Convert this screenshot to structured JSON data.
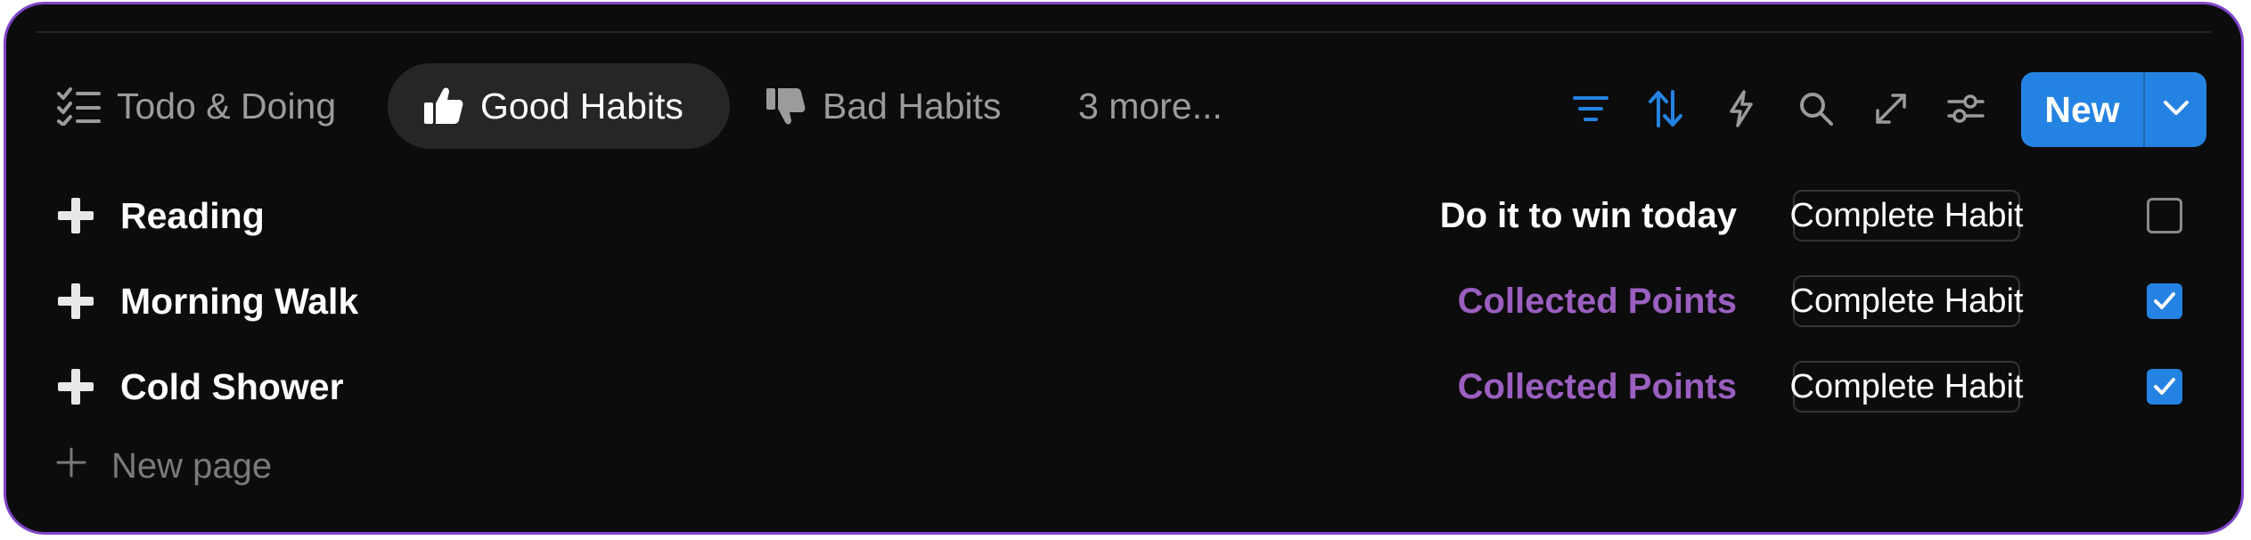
{
  "tabs": [
    {
      "label": "Todo & Doing",
      "icon": "checklist-icon",
      "active": false
    },
    {
      "label": "Good Habits",
      "icon": "thumbs-up-icon",
      "active": true
    },
    {
      "label": "Bad Habits",
      "icon": "thumbs-down-icon",
      "active": false
    },
    {
      "label": "3 more...",
      "icon": "",
      "active": false
    }
  ],
  "toolbar": {
    "icons": [
      "filter-icon",
      "sort-icon",
      "lightning-icon",
      "search-icon",
      "expand-icon",
      "settings-sliders-icon"
    ],
    "new_label": "New",
    "accent": "#2483e2"
  },
  "rows": [
    {
      "title": "Reading",
      "status": "Do it to win today",
      "status_color": "#ffffff",
      "button": "Complete Habit",
      "checked": false
    },
    {
      "title": "Morning Walk",
      "status": "Collected Points",
      "status_color": "#9b5fc0",
      "button": "Complete Habit",
      "checked": true
    },
    {
      "title": "Cold Shower",
      "status": "Collected Points",
      "status_color": "#9b5fc0",
      "button": "Complete Habit",
      "checked": true
    }
  ],
  "new_page_label": "New page",
  "frame_border_color": "#7f46c8"
}
